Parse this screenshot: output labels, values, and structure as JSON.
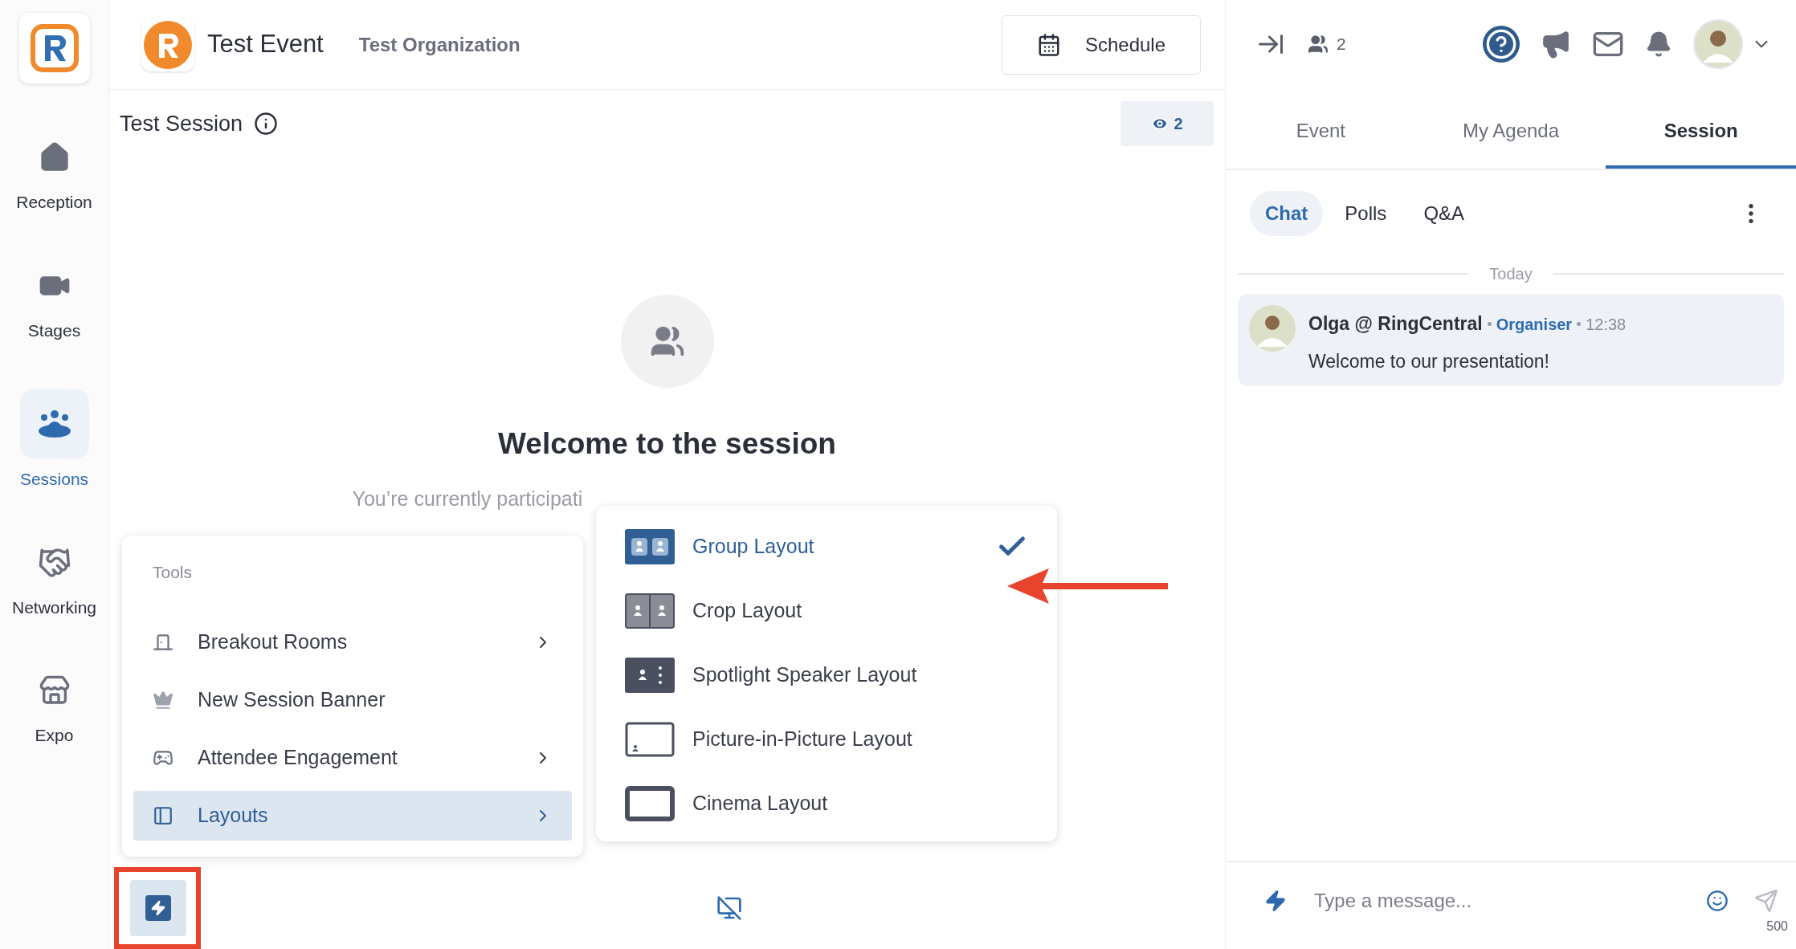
{
  "sidebar": {
    "items": [
      {
        "label": "Reception",
        "selected": false
      },
      {
        "label": "Stages",
        "selected": false
      },
      {
        "label": "Sessions",
        "selected": true
      },
      {
        "label": "Networking",
        "selected": false
      },
      {
        "label": "Expo",
        "selected": false
      }
    ]
  },
  "header": {
    "event_title": "Test Event",
    "organization": "Test Organization",
    "schedule_button": "Schedule"
  },
  "session": {
    "title": "Test Session",
    "viewer_count": "2",
    "welcome_title": "Welcome to the session",
    "welcome_text": "You’re currently participati"
  },
  "tools_menu": {
    "heading": "Tools",
    "items": [
      {
        "label": "Breakout Rooms",
        "has_submenu": true,
        "selected": false
      },
      {
        "label": "New Session Banner",
        "has_submenu": false,
        "selected": false
      },
      {
        "label": "Attendee Engagement",
        "has_submenu": true,
        "selected": false
      },
      {
        "label": "Layouts",
        "has_submenu": true,
        "selected": true
      }
    ]
  },
  "layouts_menu": {
    "items": [
      {
        "label": "Group Layout",
        "kind": "group",
        "selected": true
      },
      {
        "label": "Crop Layout",
        "kind": "crop",
        "selected": false
      },
      {
        "label": "Spotlight Speaker Layout",
        "kind": "spotlight",
        "selected": false
      },
      {
        "label": "Picture-in-Picture Layout",
        "kind": "pip",
        "selected": false
      },
      {
        "label": "Cinema Layout",
        "kind": "cinema",
        "selected": false
      }
    ]
  },
  "top_bar": {
    "participant_count": "2"
  },
  "tabs": [
    {
      "label": "Event",
      "selected": false
    },
    {
      "label": "My Agenda",
      "selected": false
    },
    {
      "label": "Session",
      "selected": true
    }
  ],
  "subtabs": [
    {
      "label": "Chat",
      "selected": true
    },
    {
      "label": "Polls",
      "selected": false
    },
    {
      "label": "Q&A",
      "selected": false
    }
  ],
  "chat": {
    "date_divider": "Today",
    "messages": [
      {
        "author": "Olga @ RingCentral",
        "role": "Organiser",
        "time": "12:38",
        "text": "Welcome to our presentation!"
      }
    ]
  },
  "composer": {
    "placeholder": "Type a message...",
    "char_limit": "500"
  }
}
